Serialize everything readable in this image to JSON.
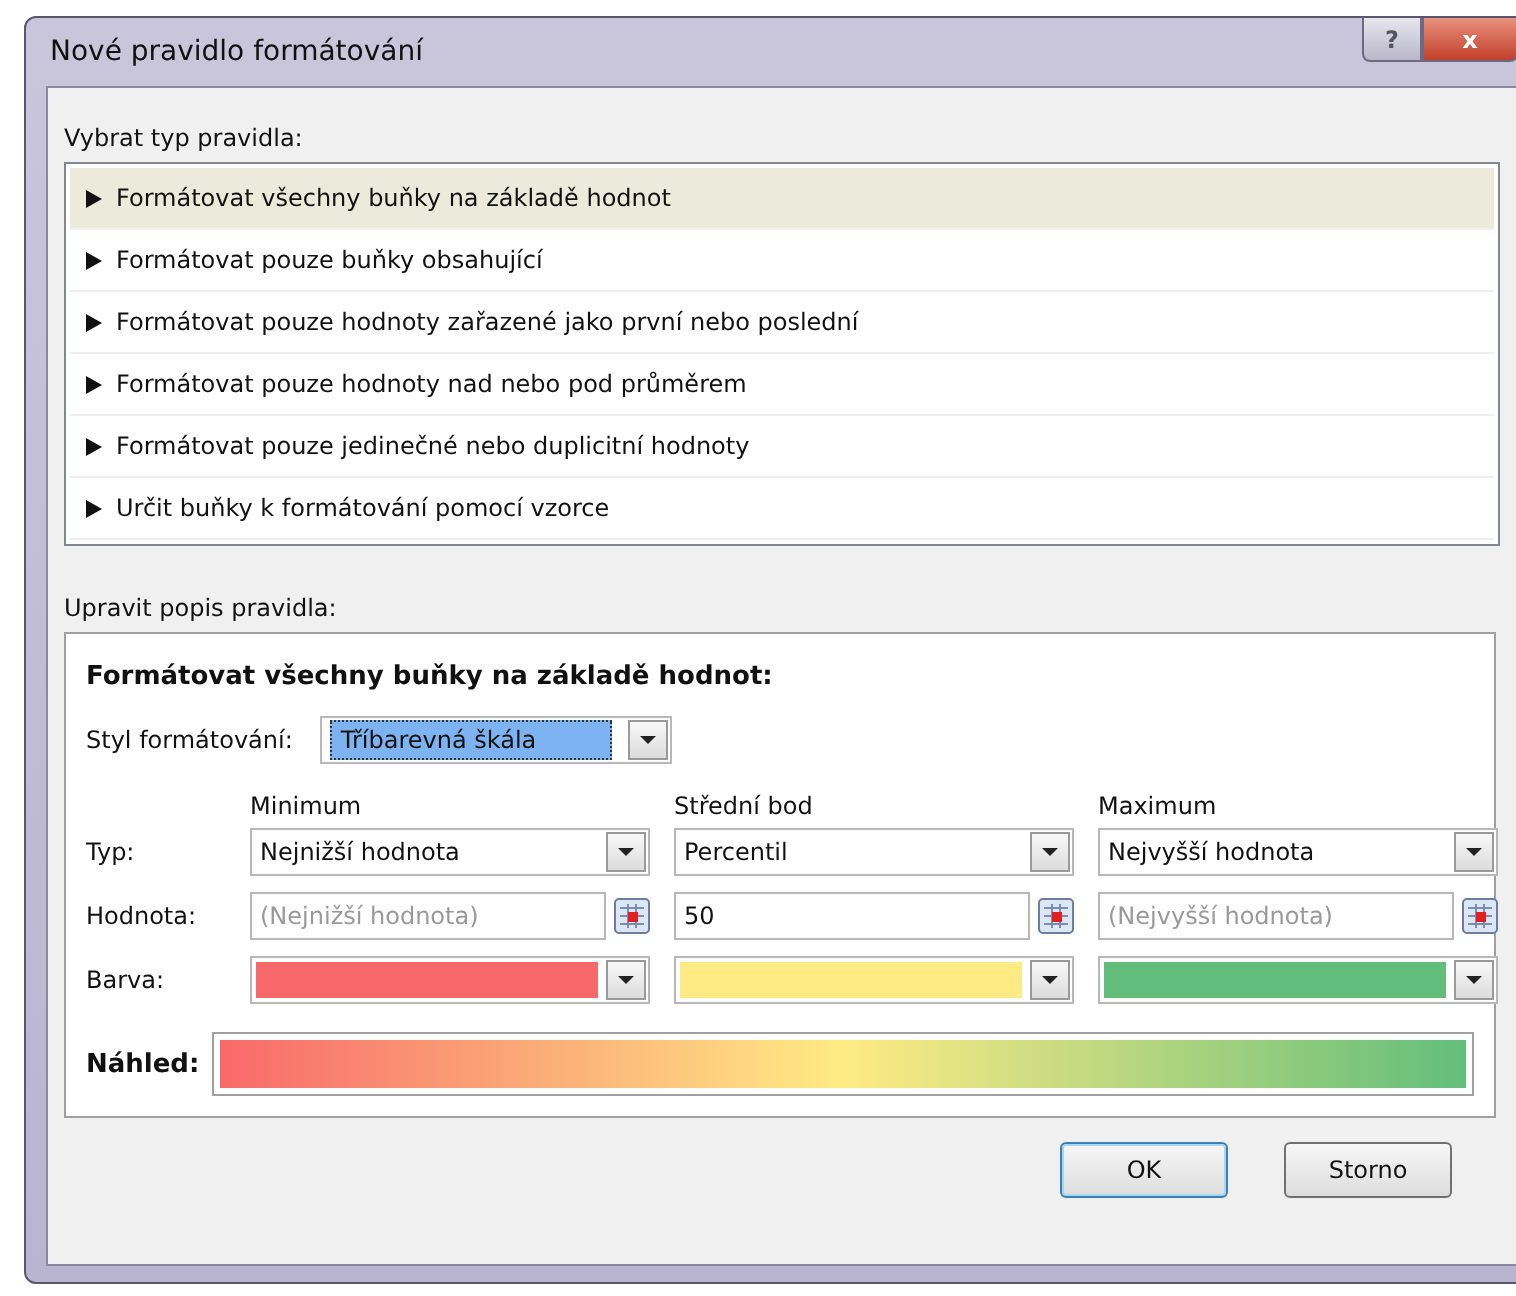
{
  "window": {
    "title": "Nové pravidlo formátování",
    "help_button": "?",
    "close_button": "x"
  },
  "rule_type": {
    "label": "Vybrat typ pravidla:",
    "items": [
      {
        "text": "Formátovat všechny buňky na základě hodnot",
        "selected": true
      },
      {
        "text": "Formátovat pouze buňky obsahující",
        "selected": false
      },
      {
        "text": "Formátovat pouze hodnoty zařazené jako první nebo poslední",
        "selected": false
      },
      {
        "text": "Formátovat pouze hodnoty nad nebo pod průměrem",
        "selected": false
      },
      {
        "text": "Formátovat pouze jedinečné nebo duplicitní hodnoty",
        "selected": false
      },
      {
        "text": "Určit buňky k formátování pomocí vzorce",
        "selected": false
      }
    ]
  },
  "rule_description": {
    "label": "Upravit popis pravidla:",
    "heading": "Formátovat všechny buňky na základě hodnot:",
    "format_style": {
      "label": "Styl formátování:",
      "value": "Tříbarevná škála"
    },
    "row_labels": {
      "type_row": "Typ:",
      "value_row": "Hodnota:",
      "color_row": "Barva:"
    },
    "columns": [
      {
        "header": "Minimum",
        "type": "Nejnižší hodnota",
        "value": "(Nejnižší hodnota)",
        "value_disabled": true,
        "color": "#f8696b"
      },
      {
        "header": "Střední bod",
        "type": "Percentil",
        "value": "50",
        "value_disabled": false,
        "color": "#ffeb84"
      },
      {
        "header": "Maximum",
        "type": "Nejvyšší hodnota",
        "value": "(Nejvyšší hodnota)",
        "value_disabled": true,
        "color": "#63be7b"
      }
    ],
    "preview_label": "Náhled:"
  },
  "buttons": [
    {
      "label": "OK",
      "default": true
    },
    {
      "label": "Storno",
      "default": false
    }
  ]
}
